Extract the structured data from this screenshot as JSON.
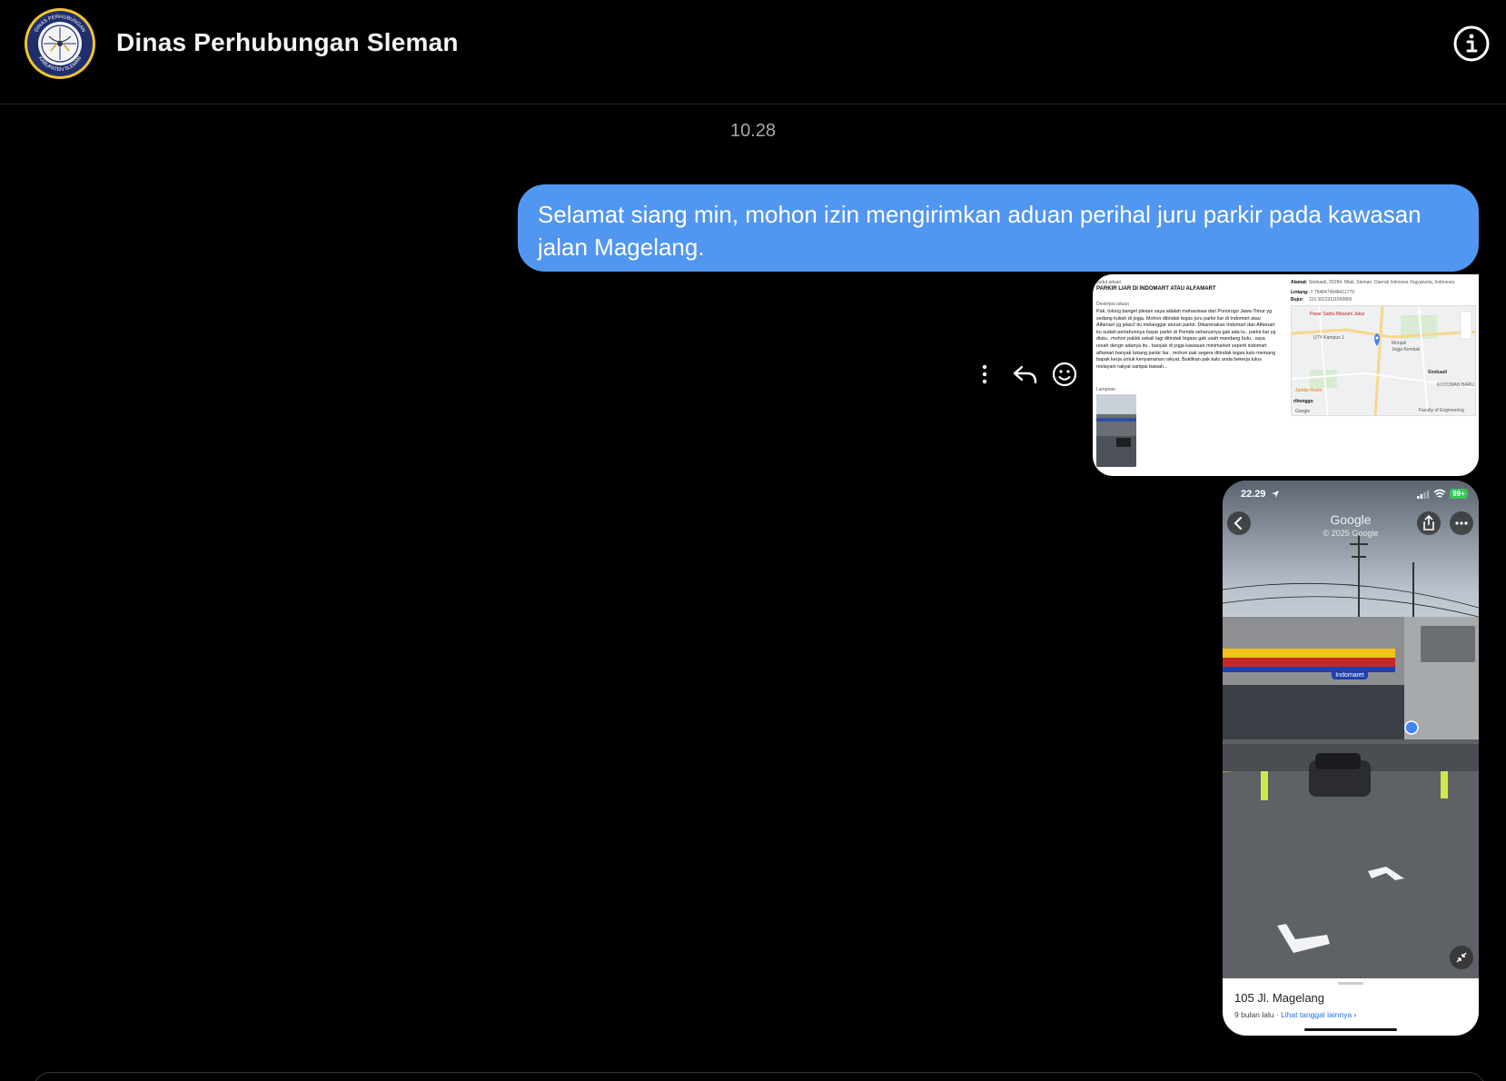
{
  "header": {
    "title": "Dinas Perhubungan Sleman",
    "avatar_icon": "dishub-sleman-logo",
    "avatar_text_top": "DINAS PERHUBUNGAN",
    "avatar_text_bottom": "KABUPATEN SLEMAN",
    "info_icon": "info-icon"
  },
  "conversation": {
    "timestamp": "10.28",
    "messages": [
      {
        "type": "text",
        "text": "Selamat siang min, mohon izin mengirimkan aduan perihal juru parkir pada kawasan jalan Magelang."
      }
    ],
    "actions": {
      "more_icon": "more-vertical-icon",
      "reply_icon": "reply-icon",
      "react_icon": "smiley-icon"
    }
  },
  "report_image": {
    "judul_label": "Judul aduan",
    "judul": "PARKIR LIAR DI INDOMART ATAU ALFAMART",
    "deskripsi_label": "Deskripsi aduan",
    "deskripsi": "Pak, tolong banget please saya adalah mahasiswa dari Ponorogo Jawa Timur yg sedang kuliah di jogja. Mohon ditindak tegas juru parkir liar di Indomart atau Alfamart yg jelas2 itu melanggar aturan parkir. Dikarenakan Indomart dan Alfamart itu sudah pertahunnya bayar parkir di Pemda seharusnya gak ada tu.. parkir liar yg diatu.. mohon pakkk sekali lagi ditindak tegass gak usah mandang bulu.. saya resah dengn adanya itu.. banyak di jogja kawasan minimarket seperti indomart alfamart banyak tukang parkir liar.. mohon pak segera ditindak tegas kalo memang bapak kerja untuk kenyamanan rakyat. Buktikan pak kalo anda bekerja tulus melayani rakyat sampai bawah...",
    "lampiran_label": "Lampiran",
    "alamat_label": "Alamat:",
    "alamat": "Sinduadi, 55284, Mlati, Sleman, Daerah Istimewa Yogyakarta, Indonesia",
    "lintang_label": "Lintang:",
    "lintang": "-7.7548474948411779",
    "bujur_label": "Bujur:",
    "bujur": "110.36223111559856",
    "map_labels": [
      "Pasar Sabtu Mbarahi Jakai",
      "UTY Kampus 1",
      "Sinduadi",
      "Monjali",
      "Jogja Kembali",
      "KOYOMAN BARU",
      "Jumbo Resto",
      "rihonggo",
      "Faculty of Engineering"
    ],
    "map_google": "Google"
  },
  "streetview": {
    "status_time": "22.29",
    "battery": "99+",
    "brand": "Google",
    "copyright": "© 2025 Google",
    "store_sign": "Indomaret",
    "address": "105 Jl. Magelang",
    "time_ago": "9 bulan lalu",
    "separator": "·",
    "more_dates": "Lihat tanggal lainnya",
    "chevron": "›"
  }
}
